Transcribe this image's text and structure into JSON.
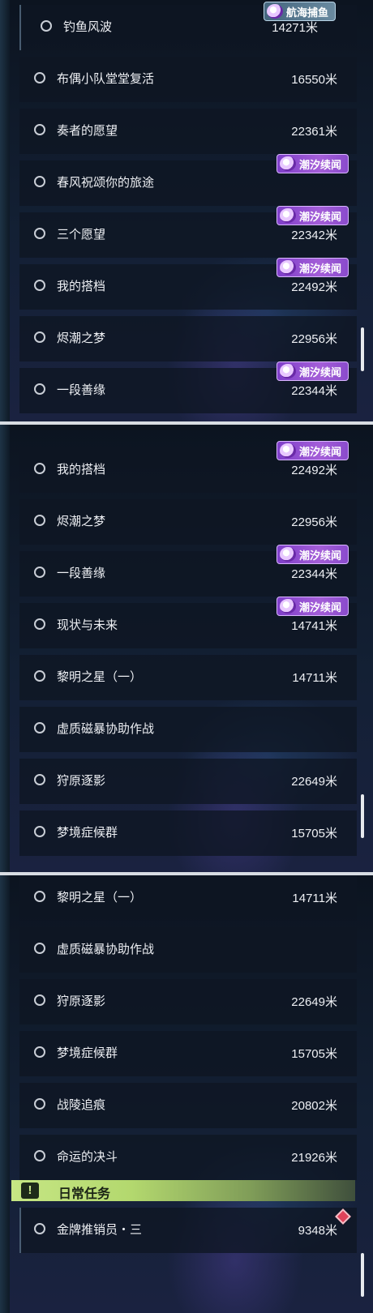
{
  "badge_label": "潮汐续闻",
  "top_badge_label": "航海捕鱼",
  "panel1": {
    "rows": [
      {
        "title": "钓鱼风波",
        "distance": "14271米"
      },
      {
        "title": "布偶小队堂堂复活",
        "distance": "16550米"
      },
      {
        "title": "奏者的愿望",
        "distance": "22361米"
      },
      {
        "title": "春风祝颂你的旅途",
        "distance": ""
      },
      {
        "title": "三个愿望",
        "distance": "22342米"
      },
      {
        "title": "我的搭档",
        "distance": "22492米"
      },
      {
        "title": "烬潮之梦",
        "distance": "22956米"
      },
      {
        "title": "一段善缘",
        "distance": "22344米"
      }
    ]
  },
  "panel2": {
    "rows": [
      {
        "title": "我的搭档",
        "distance": "22492米"
      },
      {
        "title": "烬潮之梦",
        "distance": "22956米"
      },
      {
        "title": "一段善缘",
        "distance": "22344米"
      },
      {
        "title": "现状与未来",
        "distance": "14741米"
      },
      {
        "title": "黎明之星（一）",
        "distance": "14711米"
      },
      {
        "title": "虚质磁暴协助作战",
        "distance": ""
      },
      {
        "title": "狩原逐影",
        "distance": "22649米"
      },
      {
        "title": "梦境症候群",
        "distance": "15705米"
      }
    ]
  },
  "panel3": {
    "rows": [
      {
        "title": "黎明之星（一）",
        "distance": "14711米"
      },
      {
        "title": "虚质磁暴协助作战",
        "distance": ""
      },
      {
        "title": "狩原逐影",
        "distance": "22649米"
      },
      {
        "title": "梦境症候群",
        "distance": "15705米"
      },
      {
        "title": "战陵追痕",
        "distance": "20802米"
      },
      {
        "title": "命运的决斗",
        "distance": "21926米"
      }
    ],
    "daily": {
      "icon": "!",
      "title": "日常任务",
      "row": {
        "title": "金牌推销员・三",
        "distance": "9348米"
      }
    }
  }
}
